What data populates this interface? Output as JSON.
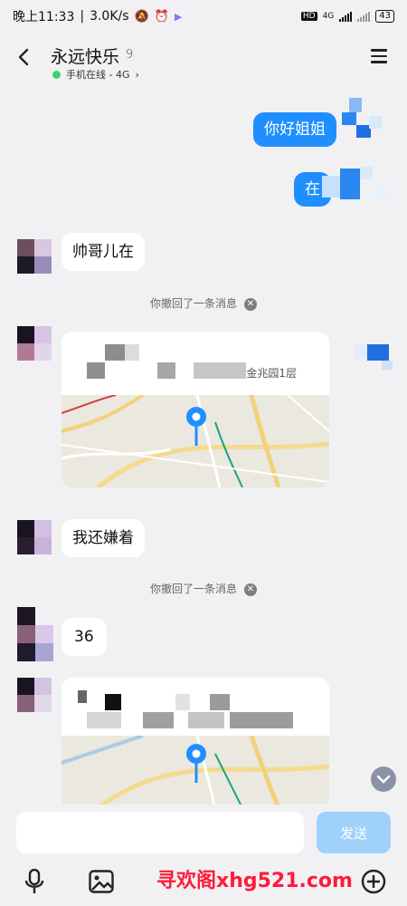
{
  "status_bar": {
    "time": "晚上11:33",
    "speed": "3.0K/s",
    "hd": "HD",
    "network": "4G",
    "battery": "43"
  },
  "header": {
    "title": "永远快乐",
    "online_status": "手机在线 - 4G"
  },
  "messages": {
    "out_1": "你好姐姐",
    "out_2": "在",
    "in_1": "帅哥儿在",
    "recall_1": "你撤回了一条消息",
    "location_1_subtitle": "金兆园1层",
    "in_2": "我还嫌着",
    "recall_2": "你撤回了一条消息",
    "in_3": "36"
  },
  "input": {
    "send_label": "发送"
  },
  "watermark": "寻欢阁xhg521.com",
  "colors": {
    "accent_blue": "#1f8fff",
    "send_disabled": "#9fd1fb",
    "online_green": "#3bd36b",
    "watermark_red": "#ff1a3c"
  }
}
